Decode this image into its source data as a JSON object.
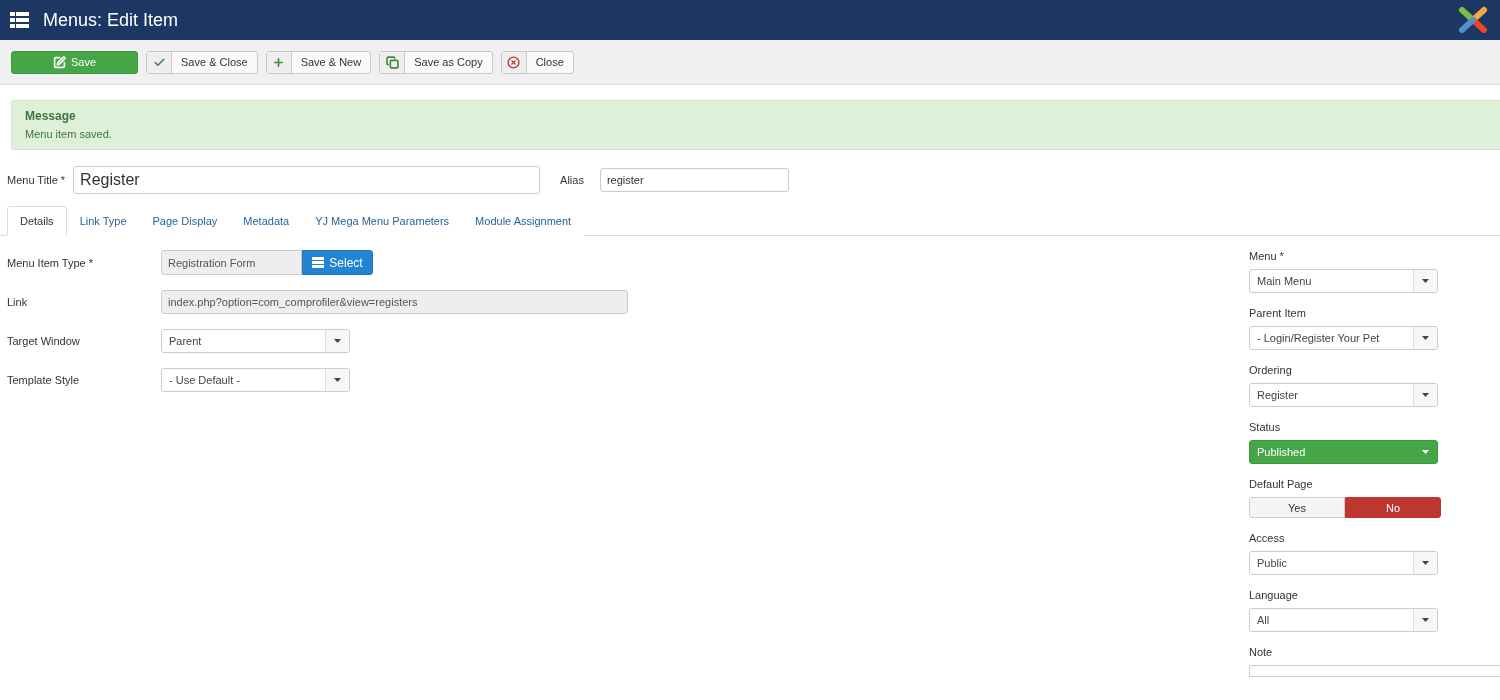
{
  "header": {
    "title": "Menus: Edit Item"
  },
  "toolbar": [
    {
      "label": "Save",
      "kind": "primary"
    },
    {
      "label": "Save & Close",
      "kind": "default"
    },
    {
      "label": "Save & New",
      "kind": "default"
    },
    {
      "label": "Save as Copy",
      "kind": "default"
    },
    {
      "label": "Close",
      "kind": "default"
    }
  ],
  "message": {
    "heading": "Message",
    "text": "Menu item saved."
  },
  "title_field": {
    "label": "Menu Title *",
    "value": "Register"
  },
  "alias_field": {
    "label": "Alias",
    "value": "register"
  },
  "tabs": [
    {
      "label": "Details",
      "selected": true
    },
    {
      "label": "Link Type",
      "selected": false
    },
    {
      "label": "Page Display",
      "selected": false
    },
    {
      "label": "Metadata",
      "selected": false
    },
    {
      "label": "YJ Mega Menu Parameters",
      "selected": false
    },
    {
      "label": "Module Assignment",
      "selected": false
    }
  ],
  "details": [
    {
      "label": "Menu Item Type *",
      "kind": "picker",
      "value": "Registration Form",
      "button": "Select"
    },
    {
      "label": "Link",
      "kind": "readonly",
      "value": "index.php?option=com_comprofiler&view=registers"
    },
    {
      "label": "Target Window",
      "kind": "select",
      "value": "Parent"
    },
    {
      "label": "Template Style",
      "kind": "select",
      "value": "- Use Default -"
    }
  ],
  "sidebar": [
    {
      "label": "Menu *",
      "kind": "select",
      "value": "Main Menu"
    },
    {
      "label": "Parent Item",
      "kind": "select",
      "value": "- Login/Register Your Pet"
    },
    {
      "label": "Ordering",
      "kind": "select",
      "value": "Register"
    },
    {
      "label": "Status",
      "kind": "status",
      "value": "Published"
    },
    {
      "label": "Default Page",
      "kind": "toggle",
      "options": [
        {
          "label": "Yes",
          "selected": false
        },
        {
          "label": "No",
          "selected": true
        }
      ]
    },
    {
      "label": "Access",
      "kind": "select",
      "value": "Public"
    },
    {
      "label": "Language",
      "kind": "select",
      "value": "All"
    },
    {
      "label": "Note",
      "kind": "text"
    }
  ]
}
